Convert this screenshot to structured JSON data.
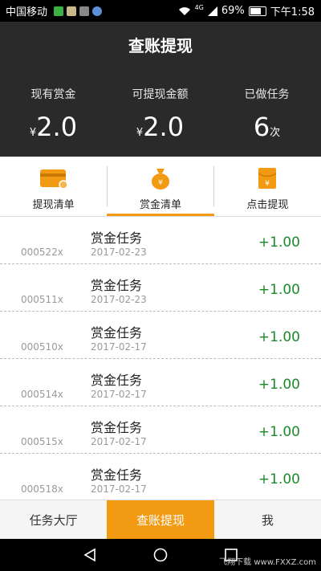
{
  "status_bar": {
    "carrier": "中国移动",
    "network": "4G",
    "battery": "69%",
    "time": "下午1:58"
  },
  "header": {
    "title": "查账提现",
    "stats": [
      {
        "label": "现有赏金",
        "prefix": "¥",
        "value": "2.0",
        "suffix": ""
      },
      {
        "label": "可提现金额",
        "prefix": "¥",
        "value": "2.0",
        "suffix": ""
      },
      {
        "label": "已做任务",
        "prefix": "",
        "value": "6",
        "suffix": "次"
      }
    ]
  },
  "tabs": [
    {
      "label": "提现清单",
      "icon": "card-icon",
      "active": false
    },
    {
      "label": "赏金清单",
      "icon": "money-bag-icon",
      "active": true
    },
    {
      "label": "点击提现",
      "icon": "red-envelope-icon",
      "active": false
    }
  ],
  "records": [
    {
      "id": "000522x",
      "name": "赏金任务",
      "date": "2017-02-23",
      "amount": "+1.00"
    },
    {
      "id": "000511x",
      "name": "赏金任务",
      "date": "2017-02-23",
      "amount": "+1.00"
    },
    {
      "id": "000510x",
      "name": "赏金任务",
      "date": "2017-02-17",
      "amount": "+1.00"
    },
    {
      "id": "000514x",
      "name": "赏金任务",
      "date": "2017-02-17",
      "amount": "+1.00"
    },
    {
      "id": "000515x",
      "name": "赏金任务",
      "date": "2017-02-17",
      "amount": "+1.00"
    },
    {
      "id": "000518x",
      "name": "赏金任务",
      "date": "2017-02-17",
      "amount": "+1.00"
    }
  ],
  "bottom_nav": [
    {
      "label": "任务大厅",
      "active": false
    },
    {
      "label": "查账提现",
      "active": true
    },
    {
      "label": "我",
      "active": false
    }
  ],
  "colors": {
    "accent": "#f39a13",
    "header_bg": "#2a2a2a",
    "amount": "#1a8a2a"
  },
  "watermark": "飞翔下载 www.FXXZ.com"
}
